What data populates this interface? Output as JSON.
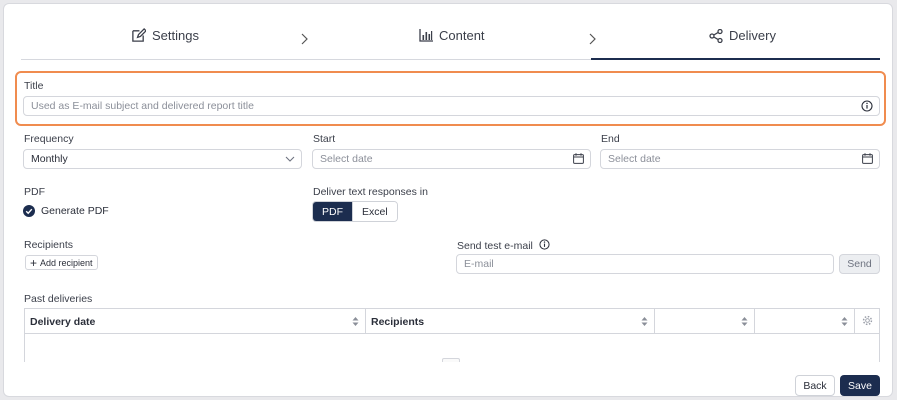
{
  "stepper": {
    "steps": [
      {
        "label": "Settings",
        "icon": "edit-icon"
      },
      {
        "label": "Content",
        "icon": "bar-chart-icon"
      },
      {
        "label": "Delivery",
        "icon": "share-icon"
      }
    ],
    "active_step": "Delivery"
  },
  "title_field": {
    "label": "Title",
    "placeholder": "Used as E-mail subject and delivered report title",
    "value": "",
    "icon": "info-icon"
  },
  "frequency": {
    "label": "Frequency",
    "value": "Monthly",
    "icon": "chevron-down-icon"
  },
  "start": {
    "label": "Start",
    "placeholder": "Select date",
    "icon": "calendar-icon"
  },
  "end": {
    "label": "End",
    "placeholder": "Select date",
    "icon": "calendar-icon"
  },
  "pdf": {
    "label": "PDF",
    "checkbox_label": "Generate PDF",
    "checked": true
  },
  "deliver_text": {
    "label": "Deliver text responses in",
    "options": [
      "PDF",
      "Excel"
    ],
    "selected": "PDF"
  },
  "recipients": {
    "label": "Recipients",
    "add_label": "Add recipient"
  },
  "test_email": {
    "label": "Send test e-mail",
    "placeholder": "E-mail",
    "send_label": "Send",
    "icon": "info-icon"
  },
  "past_deliveries": {
    "label": "Past deliveries",
    "columns": [
      "Delivery date",
      "Recipients",
      "",
      ""
    ],
    "rows": []
  },
  "footer": {
    "back_label": "Back",
    "save_label": "Save"
  },
  "colors": {
    "accent": "#1c2d4f",
    "highlight": "#f08c4f",
    "border": "#d4d6dc"
  }
}
